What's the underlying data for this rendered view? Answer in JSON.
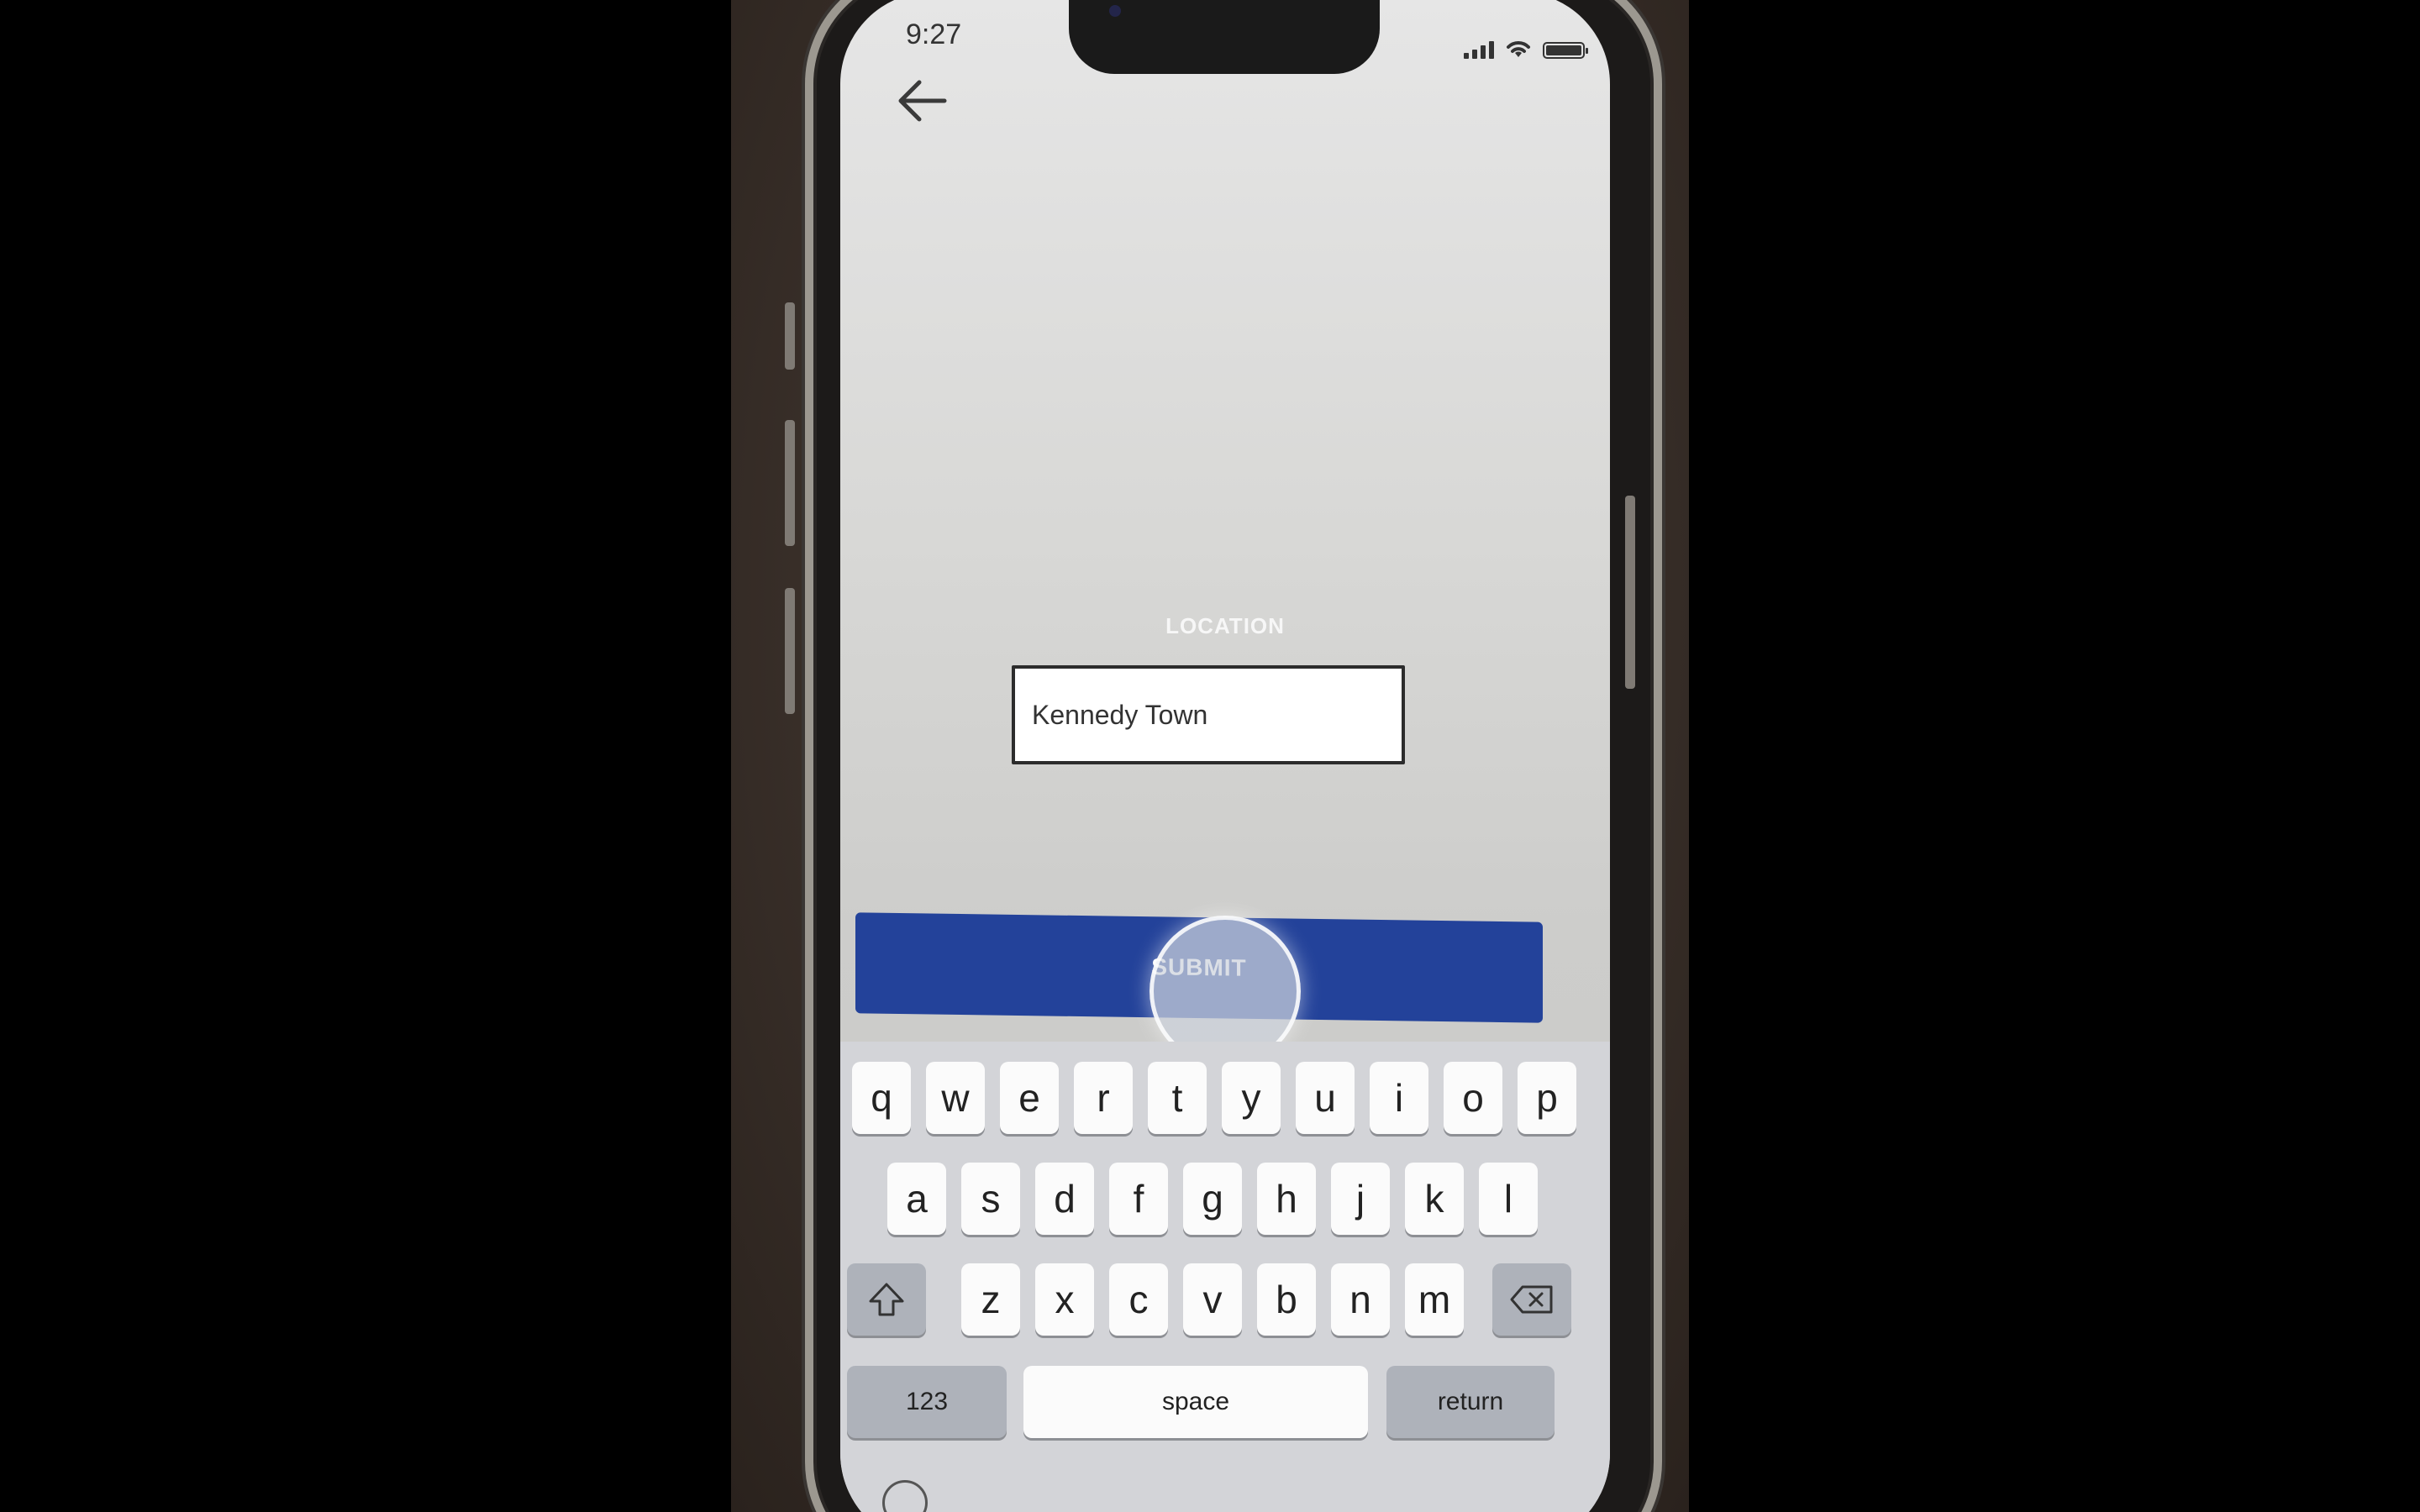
{
  "status_bar": {
    "time": "9:27"
  },
  "form": {
    "location_label": "LOCATION",
    "location_value": "Kennedy Town",
    "submit_label": "SUBMIT"
  },
  "keyboard": {
    "row1": [
      "q",
      "w",
      "e",
      "r",
      "t",
      "y",
      "u",
      "i",
      "o",
      "p"
    ],
    "row2": [
      "a",
      "s",
      "d",
      "f",
      "g",
      "h",
      "j",
      "k",
      "l"
    ],
    "row3": [
      "z",
      "x",
      "c",
      "v",
      "b",
      "n",
      "m"
    ],
    "numbers_label": "123",
    "space_label": "space",
    "return_label": "return"
  },
  "icons": {
    "back": "arrow-left-icon",
    "shift": "shift-icon",
    "delete": "backspace-icon",
    "signal": "cellular-signal-icon",
    "wifi": "wifi-icon",
    "battery": "battery-icon",
    "emoji": "emoji-icon"
  }
}
